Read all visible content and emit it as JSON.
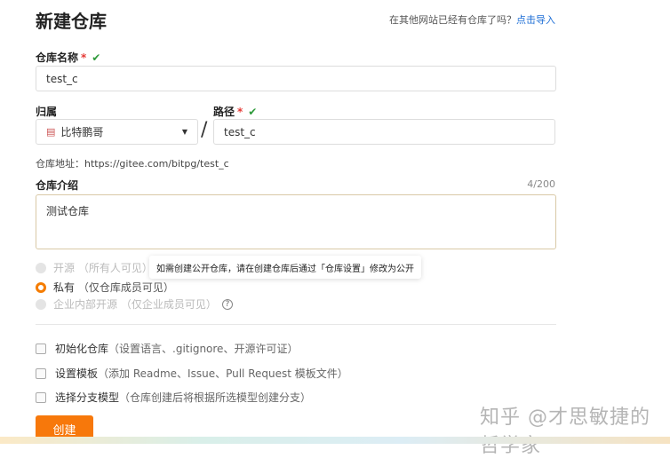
{
  "header": {
    "title": "新建仓库",
    "import_prompt": "在其他网站已经有仓库了吗？",
    "import_link": "点击导入"
  },
  "repo_name": {
    "label": "仓库名称",
    "required": "*",
    "value": "test_c"
  },
  "owner": {
    "label": "归属",
    "value": "比特鹏哥"
  },
  "separator": "/",
  "path": {
    "label": "路径",
    "required": "*",
    "value": "test_c"
  },
  "address": {
    "label": "仓库地址：",
    "value": "https://gitee.com/bitpg/test_c"
  },
  "description": {
    "label": "仓库介绍",
    "counter": "4/200",
    "value": "测试仓库"
  },
  "visibility": [
    {
      "label": "开源",
      "hint": "（所有人可见）",
      "selected": false,
      "disabled": true
    },
    {
      "label": "私有",
      "hint": "（仅仓库成员可见）",
      "selected": true,
      "disabled": false
    },
    {
      "label": "企业内部开源",
      "hint": "（仅企业成员可见）",
      "selected": false,
      "disabled": true
    }
  ],
  "help_glyph": "?",
  "tooltip": "如需创建公开仓库，请在创建仓库后通过「仓库设置」修改为公开",
  "options": [
    {
      "label": "初始化仓库",
      "hint": "（设置语言、.gitignore、开源许可证）"
    },
    {
      "label": "设置模板",
      "hint": "（添加 Readme、Issue、Pull Request 模板文件）"
    },
    {
      "label": "选择分支模型",
      "hint": "（仓库创建后将根据所选模型创建分支）"
    }
  ],
  "create_button": "创建",
  "watermark": "知乎 @才思敏捷的哲学家",
  "colors": {
    "accent": "#f7780b",
    "link": "#1f6fd6",
    "check": "#2e9a3a"
  }
}
